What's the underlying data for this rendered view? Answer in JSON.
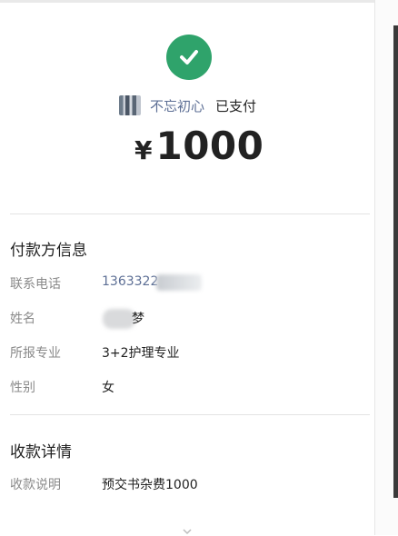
{
  "header": {
    "payer_name": "不忘初心",
    "status": "已支付",
    "currency_symbol": "¥",
    "amount": "1000"
  },
  "payer_section": {
    "title": "付款方信息",
    "rows": [
      {
        "label": "联系电话",
        "value": "1363322"
      },
      {
        "label": "姓名",
        "value": "梦"
      },
      {
        "label": "所报专业",
        "value": "3+2护理专业"
      },
      {
        "label": "性别",
        "value": "女"
      }
    ]
  },
  "payment_section": {
    "title": "收款详情",
    "rows": [
      {
        "label": "收款说明",
        "value": "预交书杂费1000"
      }
    ]
  },
  "icons": {
    "status_icon": "check-circle-icon",
    "bottom_icon": "chevron-down-icon"
  },
  "colors": {
    "success_green": "#2fa36b",
    "link_blue": "#5d6f95"
  }
}
